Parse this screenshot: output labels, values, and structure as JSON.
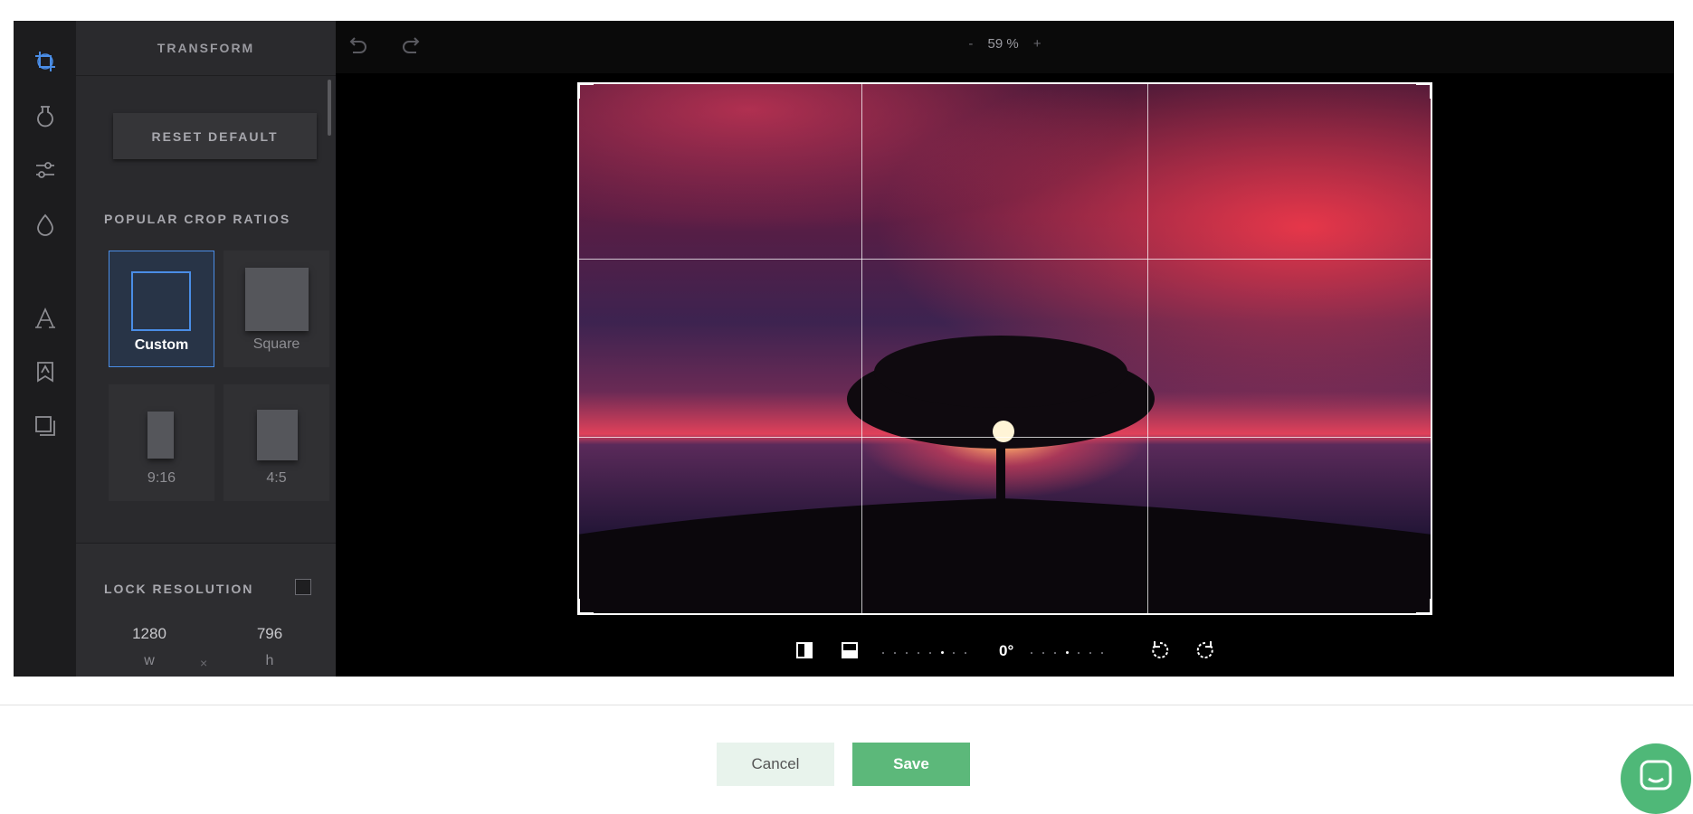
{
  "panel": {
    "title": "TRANSFORM",
    "reset_label": "RESET DEFAULT",
    "ratios_label": "POPULAR CROP RATIOS",
    "ratios": [
      {
        "name": "Custom",
        "active": true
      },
      {
        "name": "Square",
        "active": false
      },
      {
        "name": "9:16",
        "active": false
      },
      {
        "name": "4:5",
        "active": false
      }
    ],
    "lock_label": "LOCK RESOLUTION",
    "lock_checked": false,
    "width_value": "1280",
    "height_value": "796",
    "width_unit": "w",
    "height_unit": "h",
    "times_sign": "×"
  },
  "rail": {
    "icons": [
      "crop-icon",
      "filter-icon",
      "sliders-icon",
      "drop-icon",
      "text-icon",
      "sticker-icon",
      "frame-icon"
    ],
    "active": "crop-icon"
  },
  "toolbar": {
    "zoom_minus": "-",
    "zoom_value": "59 %",
    "zoom_plus": "+",
    "undo_icon": "undo-icon",
    "redo_icon": "redo-icon"
  },
  "transform": {
    "angle": "0°",
    "icons": [
      "flip-horizontal-icon",
      "flip-vertical-icon",
      "rotate-left-icon",
      "rotate-right-icon"
    ]
  },
  "footer": {
    "cancel_label": "Cancel",
    "save_label": "Save"
  },
  "colors": {
    "accent": "#4a8de6",
    "save": "#5cb87a",
    "chat": "#4fb878"
  }
}
